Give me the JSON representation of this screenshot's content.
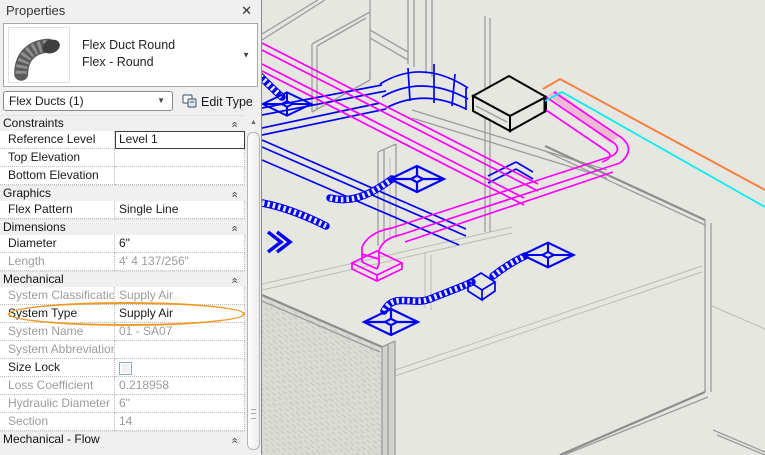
{
  "panel": {
    "title": "Properties",
    "type_selector": {
      "family": "Flex Duct Round",
      "type_name": "Flex - Round",
      "thumbnail": "flex-duct-elbow-image"
    },
    "selection_combo": {
      "value": "Flex Ducts (1)"
    },
    "edit_type_label": "Edit Type",
    "grid": {
      "sections": [
        {
          "label": "Constraints",
          "rows": [
            {
              "label": "Reference Level",
              "value": "Level 1",
              "focused": true
            },
            {
              "label": "Top Elevation",
              "value": ""
            },
            {
              "label": "Bottom Elevation",
              "value": ""
            }
          ]
        },
        {
          "label": "Graphics",
          "rows": [
            {
              "label": "Flex Pattern",
              "value": "Single Line"
            }
          ]
        },
        {
          "label": "Dimensions",
          "rows": [
            {
              "label": "Diameter",
              "value": "6\""
            },
            {
              "label": "Length",
              "value": "4'  4 137/256\"",
              "readonly": true
            }
          ]
        },
        {
          "label": "Mechanical",
          "rows": [
            {
              "label": "System Classification",
              "value": "Supply Air",
              "readonly": true
            },
            {
              "label": "System Type",
              "value": "Supply Air",
              "highlighted": true
            },
            {
              "label": "System Name",
              "value": "01 - SA07",
              "readonly": true
            },
            {
              "label": "System Abbreviation",
              "value": "",
              "readonly": true
            },
            {
              "label": "Size Lock",
              "value": "",
              "control": "checkbox",
              "checked": false
            },
            {
              "label": "Loss Coefficient",
              "value": "0.218958",
              "readonly": true
            },
            {
              "label": "Hydraulic Diameter",
              "value": "6\"",
              "readonly": true
            },
            {
              "label": "Section",
              "value": "14",
              "readonly": true
            }
          ]
        },
        {
          "label": "Mechanical - Flow",
          "rows": []
        }
      ]
    }
  },
  "icons": {
    "close": "✕",
    "dropdown": "▼",
    "collapse": "«",
    "scroll_up": "▲"
  },
  "viewport": {
    "description": "3D view of HVAC ductwork: blue supply ducts with diffusers and flex runs, magenta duct run dropping to a floor diffuser, black duct box, cyan and orange pipe lines, gray building walls",
    "colors": {
      "supply_air": "#0202f2",
      "return_air": "#ff00ff",
      "pipe_cyan": "#00eeee",
      "pipe_orange": "#f5813c",
      "walls": "#9b9b9b",
      "walls_dark": "#8d8d8d",
      "walls_faint": "#bcbcb7",
      "view_bg": "#e7e7e2",
      "black_duct": "#000000",
      "highlight_orange": "#ef9a27",
      "panel_bg": "#f0f0f0"
    }
  }
}
